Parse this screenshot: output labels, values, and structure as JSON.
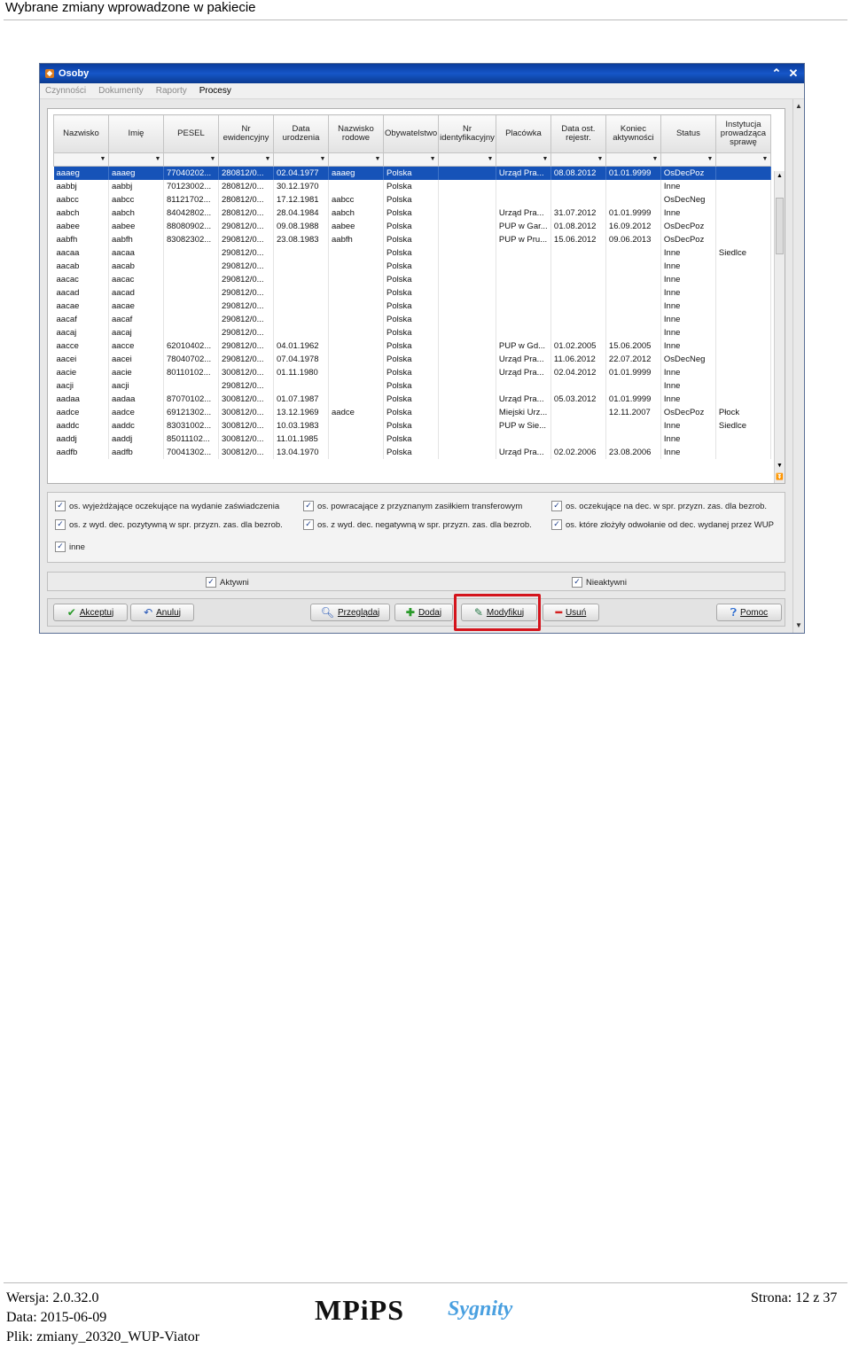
{
  "doc_header": "Wybrane zmiany wprowadzone w pakiecie",
  "window": {
    "title": "Osoby",
    "menu": [
      "Czynności",
      "Dokumenty",
      "Raporty",
      "Procesy"
    ]
  },
  "grid": {
    "columns": [
      "Nazwisko",
      "Imię",
      "PESEL",
      "Nr ewidencyjny",
      "Data urodzenia",
      "Nazwisko rodowe",
      "Obywatelstwo",
      "Nr identyfikacyjny",
      "Placówka",
      "Data ost. rejestr.",
      "Koniec aktywności",
      "Status",
      "Instytucja prowadząca sprawę"
    ],
    "rows": [
      [
        "aaaeg",
        "aaaeg",
        "77040202...",
        "280812/0...",
        "02.04.1977",
        "aaaeg",
        "Polska",
        "",
        "Urząd Pra...",
        "08.08.2012",
        "01.01.9999",
        "OsDecPoz",
        ""
      ],
      [
        "aabbj",
        "aabbj",
        "70123002...",
        "280812/0...",
        "30.12.1970",
        "",
        "Polska",
        "",
        "",
        "",
        "",
        "Inne",
        ""
      ],
      [
        "aabcc",
        "aabcc",
        "81121702...",
        "280812/0...",
        "17.12.1981",
        "aabcc",
        "Polska",
        "",
        "",
        "",
        "",
        "OsDecNeg",
        ""
      ],
      [
        "aabch",
        "aabch",
        "84042802...",
        "280812/0...",
        "28.04.1984",
        "aabch",
        "Polska",
        "",
        "Urząd Pra...",
        "31.07.2012",
        "01.01.9999",
        "Inne",
        ""
      ],
      [
        "aabee",
        "aabee",
        "88080902...",
        "290812/0...",
        "09.08.1988",
        "aabee",
        "Polska",
        "",
        "PUP w Gar...",
        "01.08.2012",
        "16.09.2012",
        "OsDecPoz",
        ""
      ],
      [
        "aabfh",
        "aabfh",
        "83082302...",
        "290812/0...",
        "23.08.1983",
        "aabfh",
        "Polska",
        "",
        "PUP w Pru...",
        "15.06.2012",
        "09.06.2013",
        "OsDecPoz",
        ""
      ],
      [
        "aacaa",
        "aacaa",
        "",
        "290812/0...",
        "",
        "",
        "Polska",
        "",
        "",
        "",
        "",
        "Inne",
        "Siedlce"
      ],
      [
        "aacab",
        "aacab",
        "",
        "290812/0...",
        "",
        "",
        "Polska",
        "",
        "",
        "",
        "",
        "Inne",
        ""
      ],
      [
        "aacac",
        "aacac",
        "",
        "290812/0...",
        "",
        "",
        "Polska",
        "",
        "",
        "",
        "",
        "Inne",
        ""
      ],
      [
        "aacad",
        "aacad",
        "",
        "290812/0...",
        "",
        "",
        "Polska",
        "",
        "",
        "",
        "",
        "Inne",
        ""
      ],
      [
        "aacae",
        "aacae",
        "",
        "290812/0...",
        "",
        "",
        "Polska",
        "",
        "",
        "",
        "",
        "Inne",
        ""
      ],
      [
        "aacaf",
        "aacaf",
        "",
        "290812/0...",
        "",
        "",
        "Polska",
        "",
        "",
        "",
        "",
        "Inne",
        ""
      ],
      [
        "aacaj",
        "aacaj",
        "",
        "290812/0...",
        "",
        "",
        "Polska",
        "",
        "",
        "",
        "",
        "Inne",
        ""
      ],
      [
        "aacce",
        "aacce",
        "62010402...",
        "290812/0...",
        "04.01.1962",
        "",
        "Polska",
        "",
        "PUP w Gd...",
        "01.02.2005",
        "15.06.2005",
        "Inne",
        ""
      ],
      [
        "aacei",
        "aacei",
        "78040702...",
        "290812/0...",
        "07.04.1978",
        "",
        "Polska",
        "",
        "Urząd Pra...",
        "11.06.2012",
        "22.07.2012",
        "OsDecNeg",
        ""
      ],
      [
        "aacie",
        "aacie",
        "80110102...",
        "300812/0...",
        "01.11.1980",
        "",
        "Polska",
        "",
        "Urząd Pra...",
        "02.04.2012",
        "01.01.9999",
        "Inne",
        ""
      ],
      [
        "aacji",
        "aacji",
        "",
        "290812/0...",
        "",
        "",
        "Polska",
        "",
        "",
        "",
        "",
        "Inne",
        ""
      ],
      [
        "aadaa",
        "aadaa",
        "87070102...",
        "300812/0...",
        "01.07.1987",
        "",
        "Polska",
        "",
        "Urząd Pra...",
        "05.03.2012",
        "01.01.9999",
        "Inne",
        ""
      ],
      [
        "aadce",
        "aadce",
        "69121302...",
        "300812/0...",
        "13.12.1969",
        "aadce",
        "Polska",
        "",
        "Miejski Urz...",
        "",
        "12.11.2007",
        "OsDecPoz",
        "Płock"
      ],
      [
        "aaddc",
        "aaddc",
        "83031002...",
        "300812/0...",
        "10.03.1983",
        "",
        "Polska",
        "",
        "PUP w Sie...",
        "",
        "",
        "Inne",
        "Siedlce"
      ],
      [
        "aaddj",
        "aaddj",
        "85011102...",
        "300812/0...",
        "11.01.1985",
        "",
        "Polska",
        "",
        "",
        "",
        "",
        "Inne",
        ""
      ],
      [
        "aadfb",
        "aadfb",
        "70041302...",
        "300812/0...",
        "13.04.1970",
        "",
        "Polska",
        "",
        "Urząd Pra...",
        "02.02.2006",
        "23.08.2006",
        "Inne",
        ""
      ]
    ]
  },
  "checkboxes": {
    "wyjezdzajace": "os. wyjeżdżające oczekujące na wydanie zaświadczenia",
    "powracajace": "os. powracające z przyznanym zasiłkiem transferowym",
    "oczekujace": "os. oczekujące na dec. w spr. przyzn. zas. dla bezrob.",
    "pozytywna": "os. z wyd. dec. pozytywną w spr. przyzn. zas. dla bezrob.",
    "negatywna": "os. z wyd. dec. negatywną w spr. przyzn. zas. dla bezrob.",
    "odwolanie": "os. które złożyły odwołanie od dec. wydanej przez WUP",
    "inne": "inne",
    "aktywni": "Aktywni",
    "nieaktywni": "Nieaktywni"
  },
  "buttons": {
    "akceptuj": "Akceptuj",
    "anuluj": "Anuluj",
    "przegladaj": "Przeglądaj",
    "dodaj": "Dodaj",
    "modyfikuj": "Modyfikuj",
    "usun": "Usuń",
    "pomoc": "Pomoc"
  },
  "footer": {
    "wersja": "Wersja: 2.0.32.0",
    "data": "Data: 2015-06-09",
    "plik": "Plik: zmiany_20320_WUP-Viator",
    "strona": "Strona: 12 z 37",
    "logo_mpips": "MPiPS",
    "logo_sygnity": "Sygnity"
  }
}
